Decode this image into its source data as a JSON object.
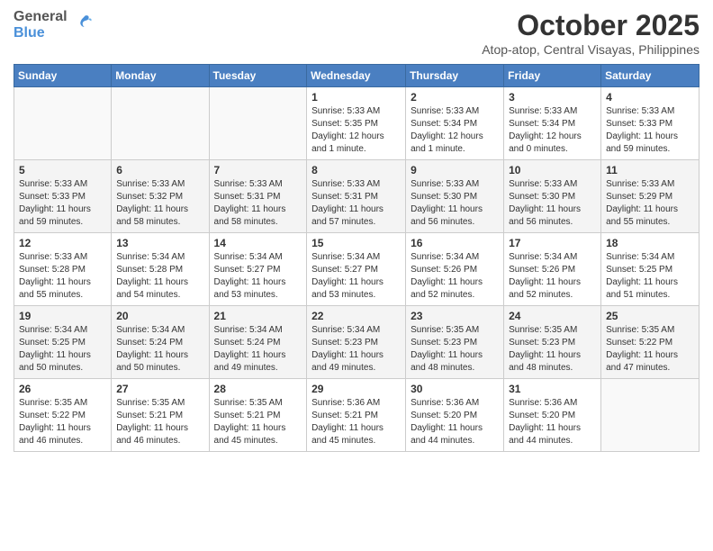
{
  "header": {
    "logo_general": "General",
    "logo_blue": "Blue",
    "month": "October 2025",
    "location": "Atop-atop, Central Visayas, Philippines"
  },
  "weekdays": [
    "Sunday",
    "Monday",
    "Tuesday",
    "Wednesday",
    "Thursday",
    "Friday",
    "Saturday"
  ],
  "weeks": [
    [
      {
        "day": "",
        "info": ""
      },
      {
        "day": "",
        "info": ""
      },
      {
        "day": "",
        "info": ""
      },
      {
        "day": "1",
        "info": "Sunrise: 5:33 AM\nSunset: 5:35 PM\nDaylight: 12 hours\nand 1 minute."
      },
      {
        "day": "2",
        "info": "Sunrise: 5:33 AM\nSunset: 5:34 PM\nDaylight: 12 hours\nand 1 minute."
      },
      {
        "day": "3",
        "info": "Sunrise: 5:33 AM\nSunset: 5:34 PM\nDaylight: 12 hours\nand 0 minutes."
      },
      {
        "day": "4",
        "info": "Sunrise: 5:33 AM\nSunset: 5:33 PM\nDaylight: 11 hours\nand 59 minutes."
      }
    ],
    [
      {
        "day": "5",
        "info": "Sunrise: 5:33 AM\nSunset: 5:33 PM\nDaylight: 11 hours\nand 59 minutes."
      },
      {
        "day": "6",
        "info": "Sunrise: 5:33 AM\nSunset: 5:32 PM\nDaylight: 11 hours\nand 58 minutes."
      },
      {
        "day": "7",
        "info": "Sunrise: 5:33 AM\nSunset: 5:31 PM\nDaylight: 11 hours\nand 58 minutes."
      },
      {
        "day": "8",
        "info": "Sunrise: 5:33 AM\nSunset: 5:31 PM\nDaylight: 11 hours\nand 57 minutes."
      },
      {
        "day": "9",
        "info": "Sunrise: 5:33 AM\nSunset: 5:30 PM\nDaylight: 11 hours\nand 56 minutes."
      },
      {
        "day": "10",
        "info": "Sunrise: 5:33 AM\nSunset: 5:30 PM\nDaylight: 11 hours\nand 56 minutes."
      },
      {
        "day": "11",
        "info": "Sunrise: 5:33 AM\nSunset: 5:29 PM\nDaylight: 11 hours\nand 55 minutes."
      }
    ],
    [
      {
        "day": "12",
        "info": "Sunrise: 5:33 AM\nSunset: 5:28 PM\nDaylight: 11 hours\nand 55 minutes."
      },
      {
        "day": "13",
        "info": "Sunrise: 5:34 AM\nSunset: 5:28 PM\nDaylight: 11 hours\nand 54 minutes."
      },
      {
        "day": "14",
        "info": "Sunrise: 5:34 AM\nSunset: 5:27 PM\nDaylight: 11 hours\nand 53 minutes."
      },
      {
        "day": "15",
        "info": "Sunrise: 5:34 AM\nSunset: 5:27 PM\nDaylight: 11 hours\nand 53 minutes."
      },
      {
        "day": "16",
        "info": "Sunrise: 5:34 AM\nSunset: 5:26 PM\nDaylight: 11 hours\nand 52 minutes."
      },
      {
        "day": "17",
        "info": "Sunrise: 5:34 AM\nSunset: 5:26 PM\nDaylight: 11 hours\nand 52 minutes."
      },
      {
        "day": "18",
        "info": "Sunrise: 5:34 AM\nSunset: 5:25 PM\nDaylight: 11 hours\nand 51 minutes."
      }
    ],
    [
      {
        "day": "19",
        "info": "Sunrise: 5:34 AM\nSunset: 5:25 PM\nDaylight: 11 hours\nand 50 minutes."
      },
      {
        "day": "20",
        "info": "Sunrise: 5:34 AM\nSunset: 5:24 PM\nDaylight: 11 hours\nand 50 minutes."
      },
      {
        "day": "21",
        "info": "Sunrise: 5:34 AM\nSunset: 5:24 PM\nDaylight: 11 hours\nand 49 minutes."
      },
      {
        "day": "22",
        "info": "Sunrise: 5:34 AM\nSunset: 5:23 PM\nDaylight: 11 hours\nand 49 minutes."
      },
      {
        "day": "23",
        "info": "Sunrise: 5:35 AM\nSunset: 5:23 PM\nDaylight: 11 hours\nand 48 minutes."
      },
      {
        "day": "24",
        "info": "Sunrise: 5:35 AM\nSunset: 5:23 PM\nDaylight: 11 hours\nand 48 minutes."
      },
      {
        "day": "25",
        "info": "Sunrise: 5:35 AM\nSunset: 5:22 PM\nDaylight: 11 hours\nand 47 minutes."
      }
    ],
    [
      {
        "day": "26",
        "info": "Sunrise: 5:35 AM\nSunset: 5:22 PM\nDaylight: 11 hours\nand 46 minutes."
      },
      {
        "day": "27",
        "info": "Sunrise: 5:35 AM\nSunset: 5:21 PM\nDaylight: 11 hours\nand 46 minutes."
      },
      {
        "day": "28",
        "info": "Sunrise: 5:35 AM\nSunset: 5:21 PM\nDaylight: 11 hours\nand 45 minutes."
      },
      {
        "day": "29",
        "info": "Sunrise: 5:36 AM\nSunset: 5:21 PM\nDaylight: 11 hours\nand 45 minutes."
      },
      {
        "day": "30",
        "info": "Sunrise: 5:36 AM\nSunset: 5:20 PM\nDaylight: 11 hours\nand 44 minutes."
      },
      {
        "day": "31",
        "info": "Sunrise: 5:36 AM\nSunset: 5:20 PM\nDaylight: 11 hours\nand 44 minutes."
      },
      {
        "day": "",
        "info": ""
      }
    ]
  ]
}
